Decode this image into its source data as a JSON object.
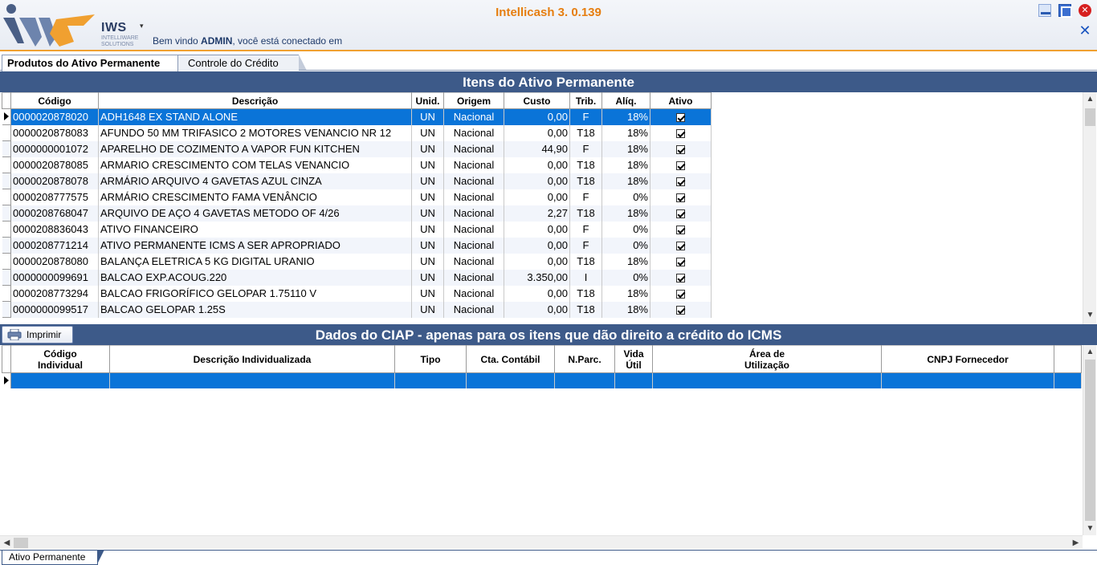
{
  "app": {
    "title": "Intellicash 3. 0.139",
    "logo_text": "IWS",
    "logo_sub": "INTELLIWARE SOLUTIONS",
    "welcome_prefix": "Bem vindo ",
    "welcome_user": "ADMIN",
    "welcome_suffix": ", você está conectado em"
  },
  "tabs": [
    {
      "label": "Produtos do Ativo Permanente",
      "active": true
    },
    {
      "label": "Controle do Crédito",
      "active": false
    }
  ],
  "items_section": {
    "title": "Itens do Ativo Permanente",
    "columns": [
      "Código",
      "Descrição",
      "Unid.",
      "Origem",
      "Custo",
      "Trib.",
      "Alíq.",
      "Ativo"
    ],
    "rows": [
      {
        "codigo": "0000020878020",
        "descricao": "ADH1648 EX STAND ALONE",
        "unid": "UN",
        "origem": "Nacional",
        "custo": "0,00",
        "trib": "F",
        "aliq": "18%",
        "ativo": true,
        "selected": true
      },
      {
        "codigo": "0000020878083",
        "descricao": "AFUNDO 50 MM TRIFASICO 2 MOTORES VENANCIO NR 12",
        "unid": "UN",
        "origem": "Nacional",
        "custo": "0,00",
        "trib": "T18",
        "aliq": "18%",
        "ativo": true
      },
      {
        "codigo": "0000000001072",
        "descricao": "APARELHO DE COZIMENTO A VAPOR FUN KITCHEN",
        "unid": "UN",
        "origem": "Nacional",
        "custo": "44,90",
        "trib": "F",
        "aliq": "18%",
        "ativo": true
      },
      {
        "codigo": "0000020878085",
        "descricao": "ARMARIO CRESCIMENTO COM TELAS VENANCIO",
        "unid": "UN",
        "origem": "Nacional",
        "custo": "0,00",
        "trib": "T18",
        "aliq": "18%",
        "ativo": true
      },
      {
        "codigo": "0000020878078",
        "descricao": "ARMÁRIO ARQUIVO 4 GAVETAS AZUL CINZA",
        "unid": "UN",
        "origem": "Nacional",
        "custo": "0,00",
        "trib": "T18",
        "aliq": "18%",
        "ativo": true
      },
      {
        "codigo": "0000208777575",
        "descricao": "ARMÁRIO CRESCIMENTO FAMA VENÂNCIO",
        "unid": "UN",
        "origem": "Nacional",
        "custo": "0,00",
        "trib": "F",
        "aliq": "0%",
        "ativo": true
      },
      {
        "codigo": "0000208768047",
        "descricao": "ARQUIVO DE AÇO 4 GAVETAS METODO OF 4/26",
        "unid": "UN",
        "origem": "Nacional",
        "custo": "2,27",
        "trib": "T18",
        "aliq": "18%",
        "ativo": true
      },
      {
        "codigo": "0000208836043",
        "descricao": "ATIVO FINANCEIRO",
        "unid": "UN",
        "origem": "Nacional",
        "custo": "0,00",
        "trib": "F",
        "aliq": "0%",
        "ativo": true
      },
      {
        "codigo": "0000208771214",
        "descricao": "ATIVO PERMANENTE ICMS A SER APROPRIADO",
        "unid": "UN",
        "origem": "Nacional",
        "custo": "0,00",
        "trib": "F",
        "aliq": "0%",
        "ativo": true
      },
      {
        "codigo": "0000020878080",
        "descricao": "BALANÇA ELETRICA 5 KG DIGITAL URANIO",
        "unid": "UN",
        "origem": "Nacional",
        "custo": "0,00",
        "trib": "T18",
        "aliq": "18%",
        "ativo": true
      },
      {
        "codigo": "0000000099691",
        "descricao": "BALCAO EXP.ACOUG.220",
        "unid": "UN",
        "origem": "Nacional",
        "custo": "3.350,00",
        "trib": "I",
        "aliq": "0%",
        "ativo": true
      },
      {
        "codigo": "0000208773294",
        "descricao": "BALCAO FRIGORÍFICO GELOPAR 1.75110 V",
        "unid": "UN",
        "origem": "Nacional",
        "custo": "0,00",
        "trib": "T18",
        "aliq": "18%",
        "ativo": true
      },
      {
        "codigo": "0000000099517",
        "descricao": "BALCAO GELOPAR 1.25S",
        "unid": "UN",
        "origem": "Nacional",
        "custo": "0,00",
        "trib": "T18",
        "aliq": "18%",
        "ativo": true
      }
    ]
  },
  "toolbar": {
    "print_label": "Imprimir"
  },
  "ciap_section": {
    "title": "Dados do CIAP - apenas para os itens que dão direito a crédito do ICMS",
    "columns": [
      "Código\nIndividual",
      "Descrição Individualizada",
      "Tipo",
      "Cta. Contábil",
      "N.Parc.",
      "Vida\nÚtil",
      "Área de\nUtilização",
      "CNPJ Fornecedor"
    ]
  },
  "bottom_tab": {
    "label": "Ativo Permanente"
  },
  "colors": {
    "banner": "#3d5a89",
    "selection": "#0a74d8",
    "title": "#e67e10",
    "accent_line": "#f0a030"
  },
  "icons": [
    "logo",
    "user-menu-arrow",
    "minimize-icon",
    "maximize-icon",
    "close-icon",
    "close-x-icon",
    "printer-icon",
    "row-pointer-icon"
  ]
}
